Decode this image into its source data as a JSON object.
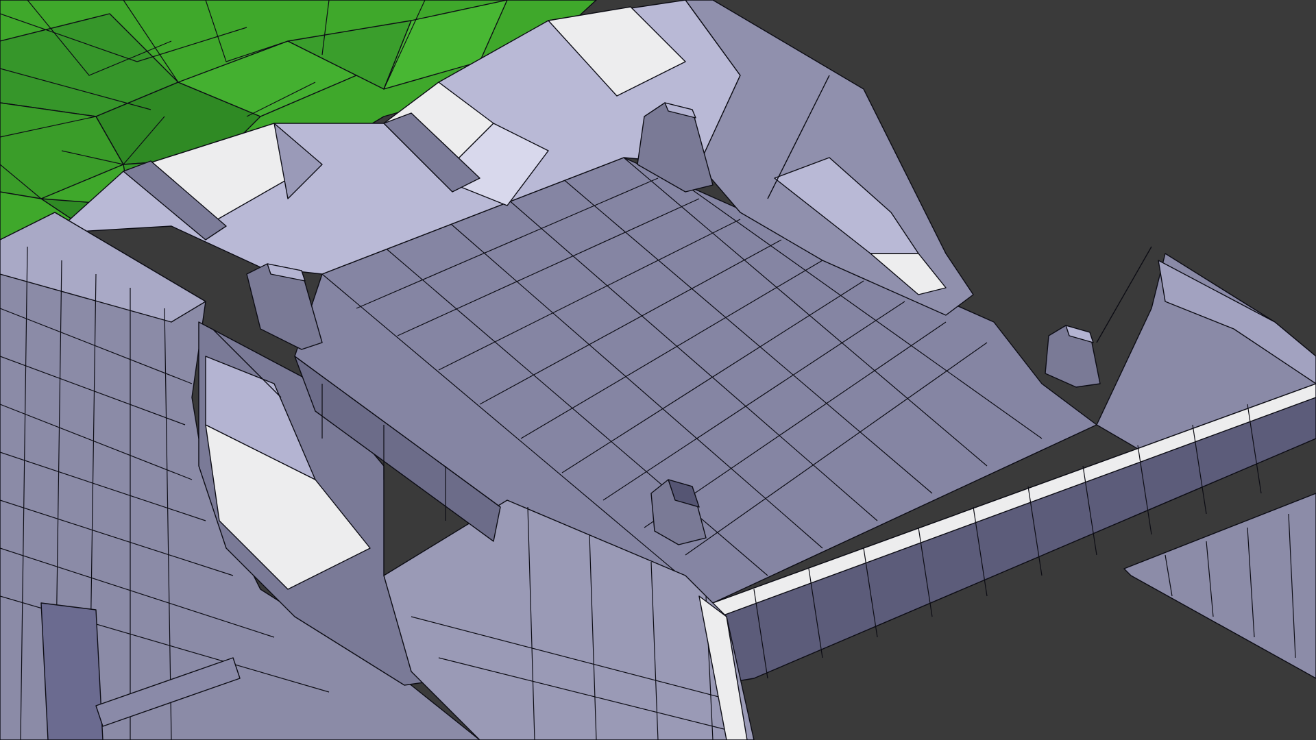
{
  "viewport": {
    "background": "#3a3a3a",
    "colors": {
      "terrain_green": "#3fa82b",
      "terrain_green_dark": "#2e7a22",
      "chassis_floor": "#8585a3",
      "chassis_side": "#6e6e8c",
      "chassis_light": "#b9b9d6",
      "chassis_highlight": "#ededee",
      "chassis_dark": "#52526d",
      "wireframe": "#0c0c14"
    },
    "objects": [
      {
        "name": "terrain-mesh",
        "material": "terrain_green"
      },
      {
        "name": "chassis-mesh",
        "material": "chassis_floor"
      }
    ]
  }
}
